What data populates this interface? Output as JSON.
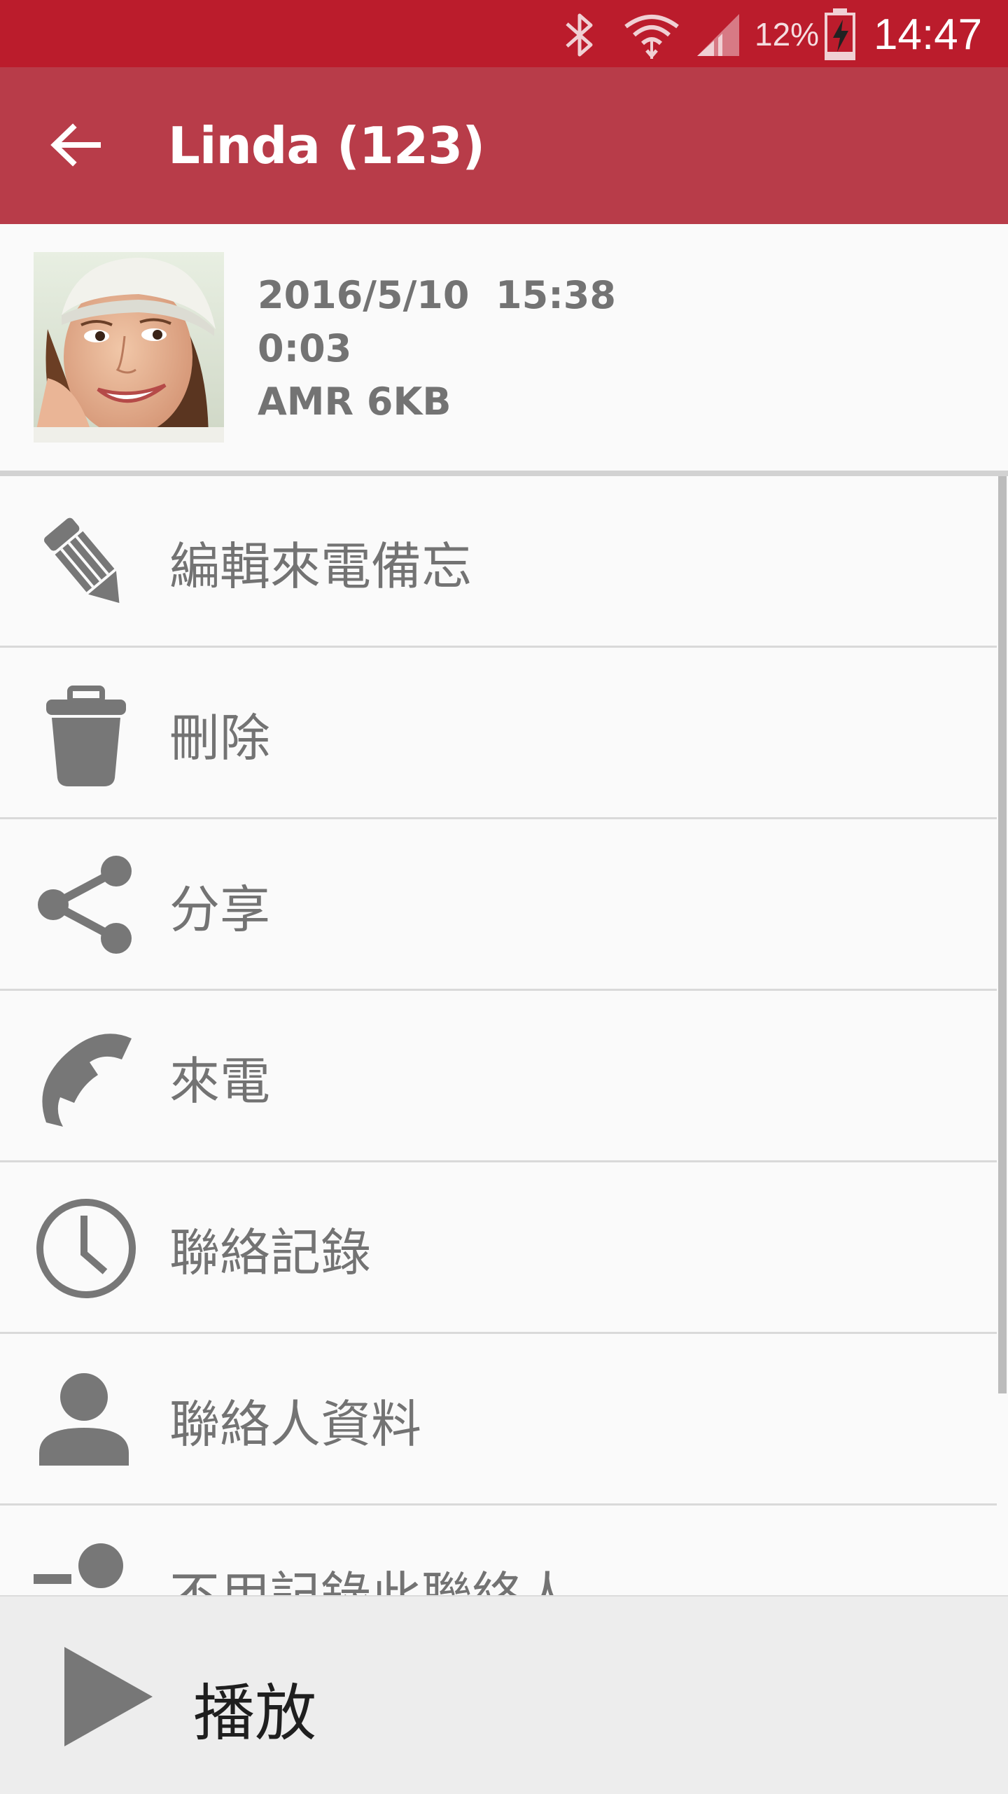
{
  "status_bar": {
    "battery_percent": "12%",
    "time": "14:47",
    "icons": [
      "bluetooth-icon",
      "wifi-icon",
      "signal-icon",
      "battery-charging-icon"
    ]
  },
  "app_bar": {
    "title": "Linda (123)",
    "back_icon": "arrow-back-icon"
  },
  "record": {
    "datetime": "2016/5/10  15:38",
    "duration": "0:03",
    "format_size": "AMR 6KB"
  },
  "menu": {
    "items": [
      {
        "label": "編輯來電備忘",
        "icon": "pencil-icon"
      },
      {
        "label": "刪除",
        "icon": "trash-icon"
      },
      {
        "label": "分享",
        "icon": "share-icon"
      },
      {
        "label": "來電",
        "icon": "phone-icon"
      },
      {
        "label": "聯絡記錄",
        "icon": "clock-icon"
      },
      {
        "label": "聯絡人資料",
        "icon": "person-icon"
      },
      {
        "label": "不用記錄此聯絡人",
        "icon": "person-remove-icon"
      }
    ]
  },
  "player": {
    "label": "播放",
    "icon": "play-icon"
  },
  "colors": {
    "status_bar": "#bb1c2c",
    "app_bar": "#b83c49",
    "icon_gray": "#777777",
    "text_gray": "#737373"
  }
}
